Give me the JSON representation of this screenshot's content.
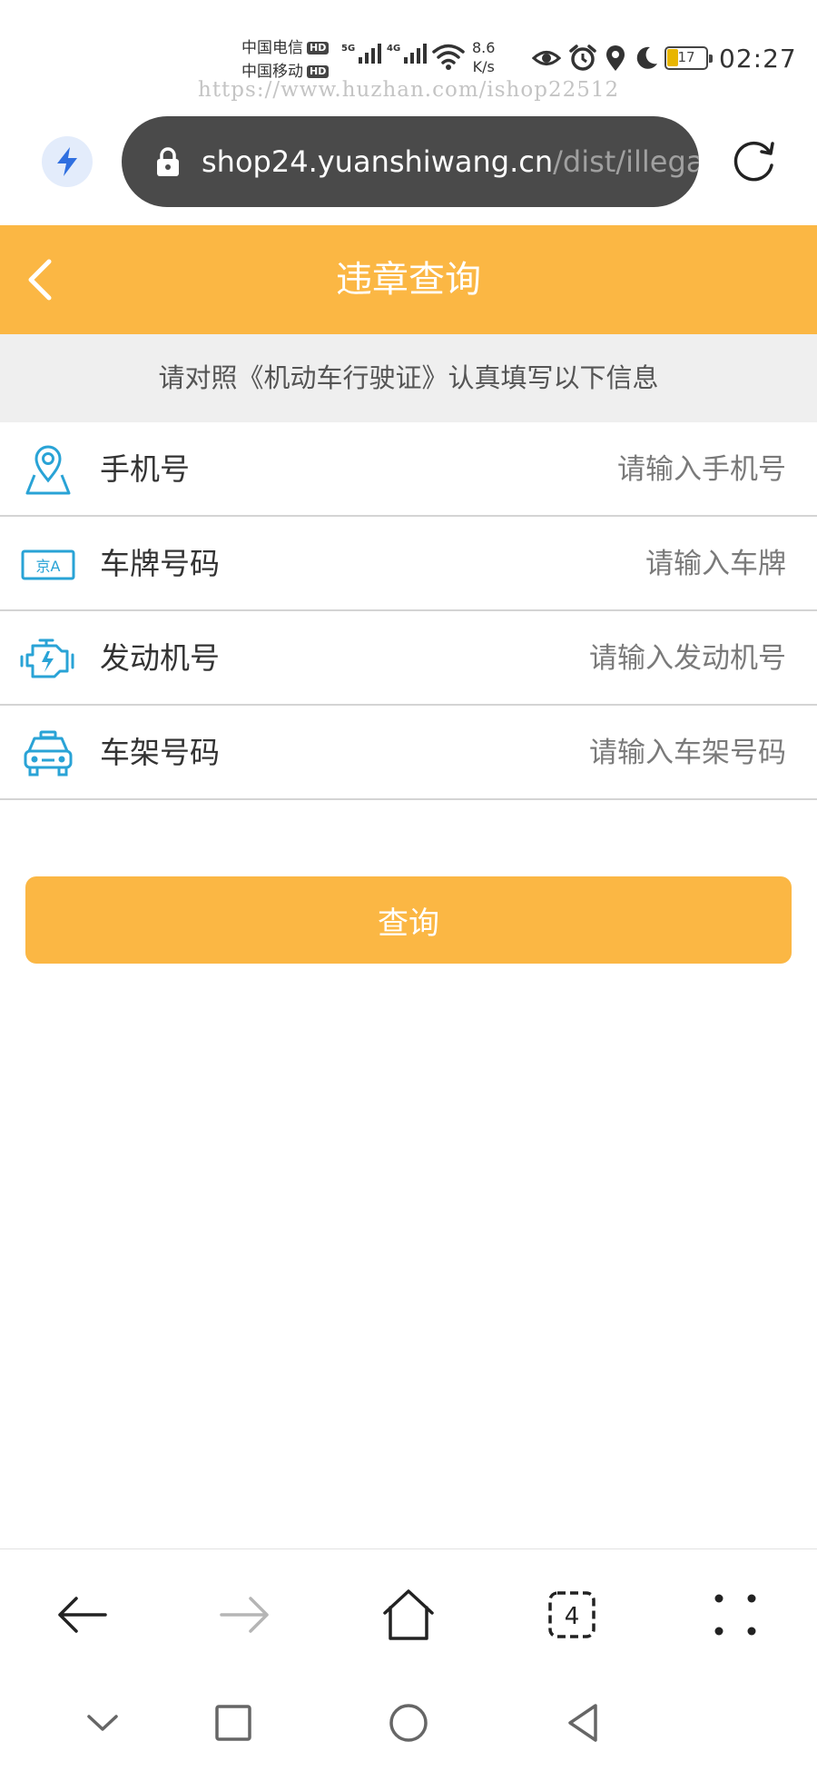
{
  "status_bar": {
    "carrier_1": "中国电信",
    "carrier_2": "中国移动",
    "hd_badge": "HD",
    "signal_1_label": "5G",
    "signal_2_label": "4G",
    "net_speed_value": "8.6",
    "net_speed_unit": "K/s",
    "battery_level": "17",
    "time": "02:27",
    "watermark": "https://www.huzhan.com/ishop22512"
  },
  "browser": {
    "url_host": "shop24.yuanshiwang.cn",
    "url_path": "/dist/illega",
    "open_tabs_count": "4"
  },
  "header": {
    "title": "违章查询"
  },
  "notice": {
    "text": "请对照《机动车行驶证》认真填写以下信息"
  },
  "form": {
    "phone": {
      "label": "手机号",
      "placeholder": "请输入手机号",
      "icon": "location-map-icon"
    },
    "plate": {
      "label": "车牌号码",
      "placeholder": "请输入车牌",
      "icon": "license-plate-icon",
      "icon_text": "京A"
    },
    "engine": {
      "label": "发动机号",
      "placeholder": "请输入发动机号",
      "icon": "engine-icon"
    },
    "vin": {
      "label": "车架号码",
      "placeholder": "请输入车架号码",
      "icon": "car-icon"
    }
  },
  "actions": {
    "submit_label": "查询"
  },
  "colors": {
    "accent": "#fbb744",
    "icon_blue": "#29a3d6",
    "url_bar": "#4a4a4a",
    "notice_bg": "#efefef"
  }
}
